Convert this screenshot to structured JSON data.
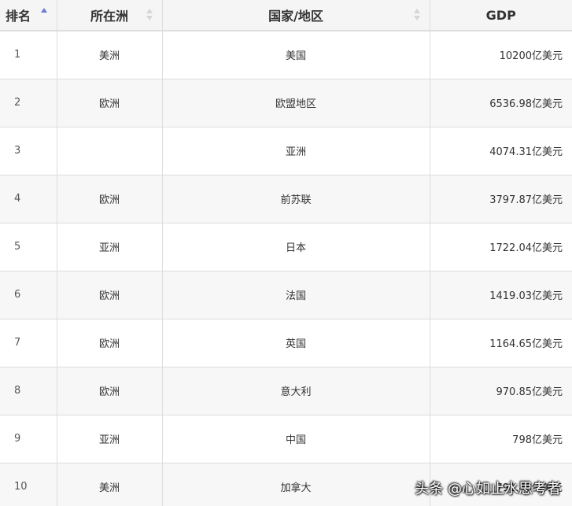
{
  "table": {
    "headers": {
      "rank": "排名",
      "continent": "所在洲",
      "country": "国家/地区",
      "gdp": "GDP"
    },
    "rows": [
      {
        "rank": "1",
        "continent": "美洲",
        "country": "美国",
        "gdp": "10200亿美元"
      },
      {
        "rank": "2",
        "continent": "欧洲",
        "country": "欧盟地区",
        "gdp": "6536.98亿美元"
      },
      {
        "rank": "3",
        "continent": "",
        "country": "亚洲",
        "gdp": "4074.31亿美元"
      },
      {
        "rank": "4",
        "continent": "欧洲",
        "country": "前苏联",
        "gdp": "3797.87亿美元"
      },
      {
        "rank": "5",
        "continent": "亚洲",
        "country": "日本",
        "gdp": "1722.04亿美元"
      },
      {
        "rank": "6",
        "continent": "欧洲",
        "country": "法国",
        "gdp": "1419.03亿美元"
      },
      {
        "rank": "7",
        "continent": "欧洲",
        "country": "英国",
        "gdp": "1164.65亿美元"
      },
      {
        "rank": "8",
        "continent": "欧洲",
        "country": "意大利",
        "gdp": "970.85亿美元"
      },
      {
        "rank": "9",
        "continent": "亚洲",
        "country": "中国",
        "gdp": "798亿美元"
      },
      {
        "rank": "10",
        "continent": "美洲",
        "country": "加拿大",
        "gdp": "791.48亿美元"
      }
    ]
  },
  "watermark": "头条 @心如止水思考者",
  "colors": {
    "header_bg": "#f5f5f5",
    "row_alt_bg": "#f7f7f7",
    "border": "#dddddd",
    "sort_active": "#6b7bd6",
    "sort_inactive": "#d6d6d6"
  }
}
